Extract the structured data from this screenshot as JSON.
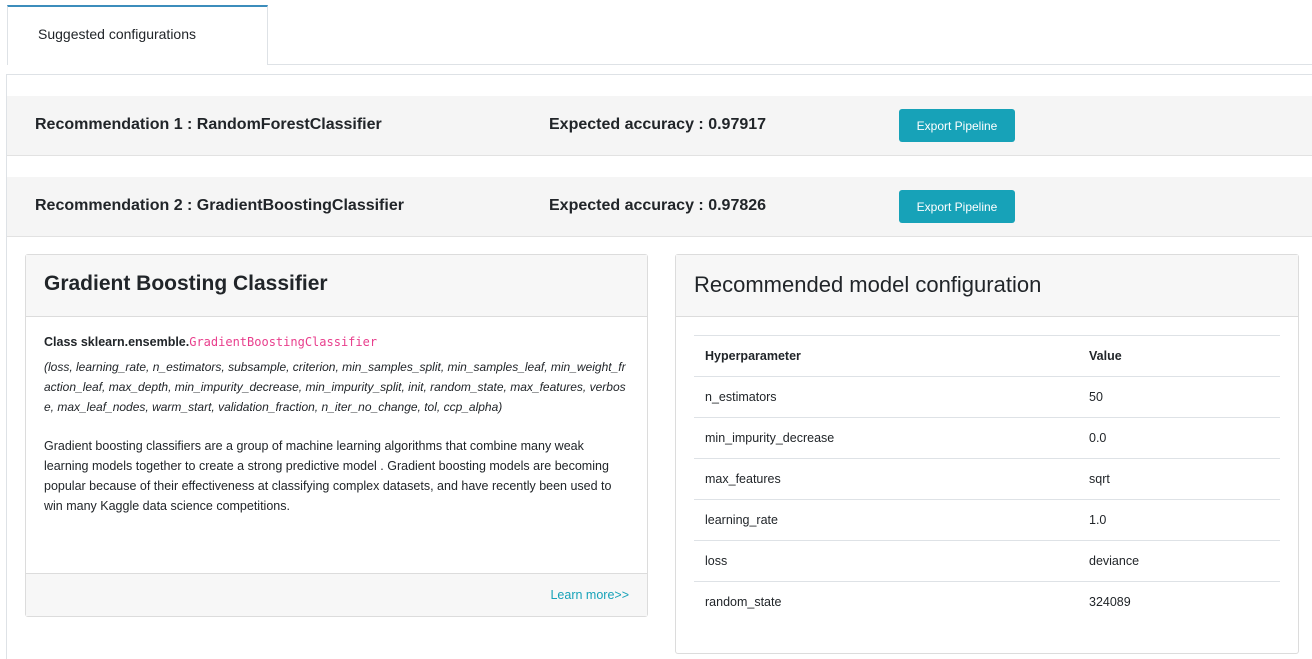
{
  "tabs": {
    "active_label": "Suggested configurations"
  },
  "recommendations": [
    {
      "title": "Recommendation 1 : RandomForestClassifier",
      "accuracy": "Expected accuracy : 0.97917",
      "button": "Export Pipeline"
    },
    {
      "title": "Recommendation 2 : GradientBoostingClassifier",
      "accuracy": "Expected accuracy : 0.97826",
      "button": "Export Pipeline"
    }
  ],
  "model_card": {
    "title": "Gradient Boosting Classifier",
    "class_prefix": "Class sklearn.ensemble.",
    "class_name": "GradientBoostingClassifier",
    "params": "(loss, learning_rate, n_estimators, subsample, criterion, min_samples_split, min_samples_leaf, min_weight_fraction_leaf, max_depth, min_impurity_decrease, min_impurity_split, init, random_state, max_features, verbose, max_leaf_nodes, warm_start, validation_fraction, n_iter_no_change, tol, ccp_alpha)",
    "description": "Gradient boosting classifiers are a group of machine learning algorithms that combine many weak learning models together to create a strong predictive model . Gradient boosting models are becoming popular because of their effectiveness at classifying complex datasets, and have recently been used to win many Kaggle data science competitions.",
    "learn_more": "Learn more>>"
  },
  "config_card": {
    "title": "Recommended model configuration",
    "headers": {
      "param": "Hyperparameter",
      "value": "Value"
    },
    "rows": [
      {
        "param": "n_estimators",
        "value": "50"
      },
      {
        "param": "min_impurity_decrease",
        "value": "0.0"
      },
      {
        "param": "max_features",
        "value": "sqrt"
      },
      {
        "param": "learning_rate",
        "value": "1.0"
      },
      {
        "param": "loss",
        "value": "deviance"
      },
      {
        "param": "random_state",
        "value": "324089"
      }
    ]
  },
  "colors": {
    "accent": "#17a2b8",
    "tab_border": "#3c8dbc",
    "code_pink": "#e83e8c"
  }
}
